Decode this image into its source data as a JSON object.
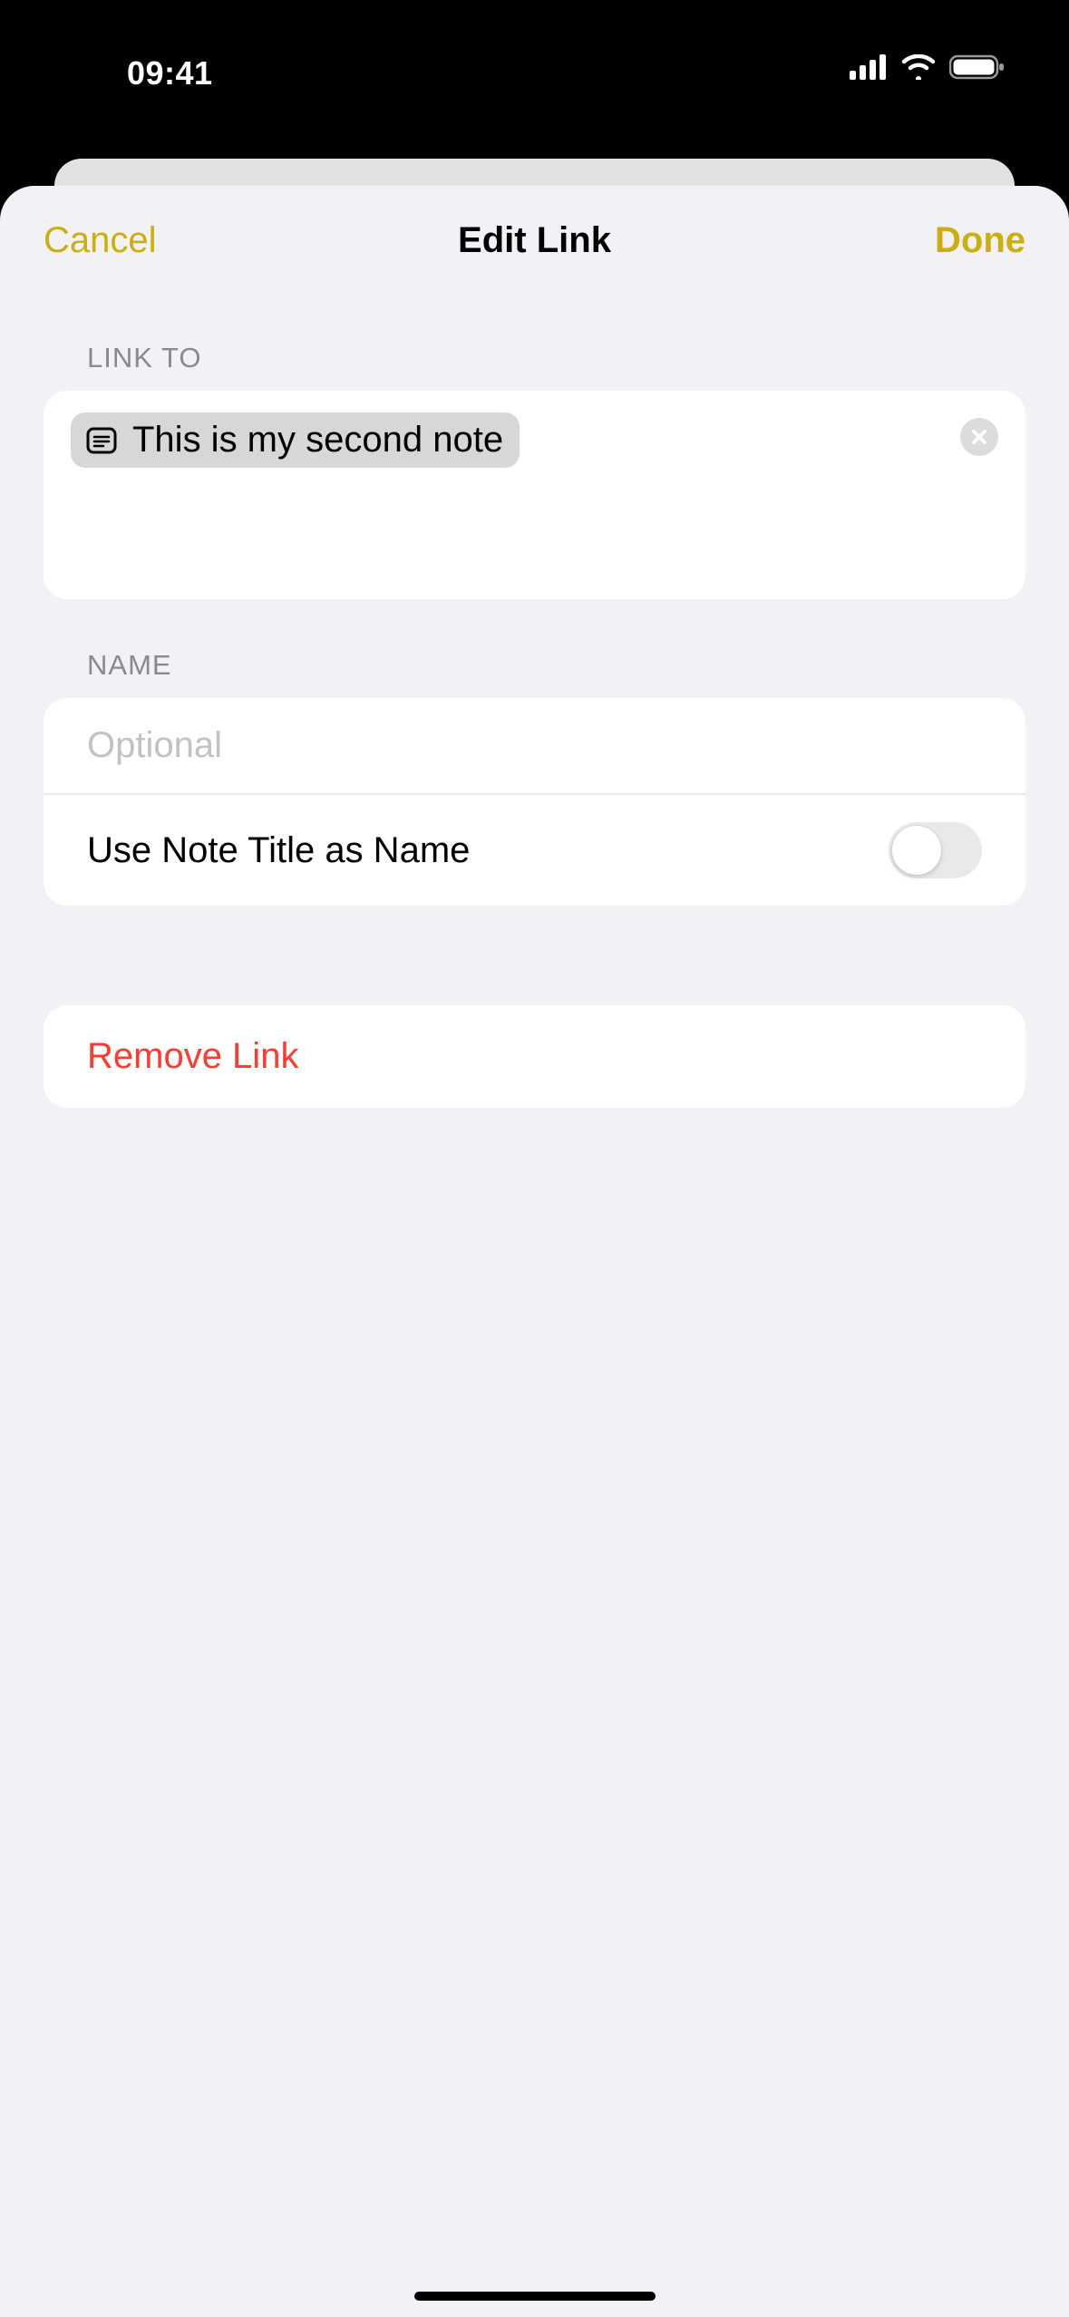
{
  "status": {
    "time": "09:41"
  },
  "nav": {
    "cancel": "Cancel",
    "title": "Edit Link",
    "done": "Done"
  },
  "link_to": {
    "header": "LINK TO",
    "chip_text": "This is my second note"
  },
  "name": {
    "header": "NAME",
    "placeholder": "Optional",
    "value": "",
    "use_title_label": "Use Note Title as Name",
    "use_title_on": false
  },
  "remove": {
    "label": "Remove Link"
  },
  "colors": {
    "accent": "#ccaf0c",
    "danger": "#ff3b30"
  }
}
